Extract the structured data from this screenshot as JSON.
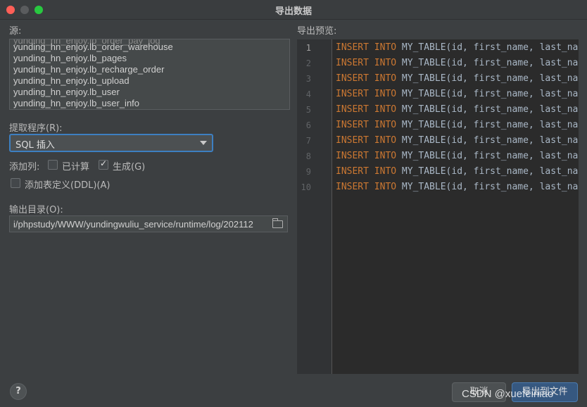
{
  "window": {
    "title": "导出数据"
  },
  "source": {
    "label": "源:",
    "items": [
      "yunding_hn_enjoy.lb_order_warehouse",
      "yunding_hn_enjoy.lb_pages",
      "yunding_hn_enjoy.lb_recharge_order",
      "yunding_hn_enjoy.lb_upload",
      "yunding_hn_enjoy.lb_user",
      "yunding_hn_enjoy.lb_user_info"
    ]
  },
  "extractor": {
    "label": "提取程序(R):",
    "value": "SQL 插入"
  },
  "add_columns": {
    "label": "添加列:",
    "computed_label": "已计算",
    "computed_checked": false,
    "generated_label": "生成(G)",
    "generated_checked": true
  },
  "ddl": {
    "label": "添加表定义(DDL)(A)",
    "checked": false
  },
  "output": {
    "label": "输出目录(O):",
    "value": "i/phpstudy/WWW/yundingwuliu_service/runtime/log/202112"
  },
  "preview": {
    "label": "导出预览:",
    "line_numbers": [
      "1",
      "2",
      "3",
      "4",
      "5",
      "6",
      "7",
      "8",
      "9",
      "10"
    ],
    "lines": [
      {
        "kw": "INSERT INTO",
        "rest": "MY_TABLE(id, first_name, last_na"
      },
      {
        "kw": "INSERT INTO",
        "rest": "MY_TABLE(id, first_name, last_na"
      },
      {
        "kw": "INSERT INTO",
        "rest": "MY_TABLE(id, first_name, last_na"
      },
      {
        "kw": "INSERT INTO",
        "rest": "MY_TABLE(id, first_name, last_na"
      },
      {
        "kw": "INSERT INTO",
        "rest": "MY_TABLE(id, first_name, last_na"
      },
      {
        "kw": "INSERT INTO",
        "rest": "MY_TABLE(id, first_name, last_na"
      },
      {
        "kw": "INSERT INTO",
        "rest": "MY_TABLE(id, first_name, last_na"
      },
      {
        "kw": "INSERT INTO",
        "rest": "MY_TABLE(id, first_name, last_na"
      },
      {
        "kw": "INSERT INTO",
        "rest": "MY_TABLE(id, first_name, last_na"
      },
      {
        "kw": "INSERT INTO",
        "rest": "MY_TABLE(id, first_name, last_na"
      }
    ]
  },
  "footer": {
    "help": "?",
    "cancel": "取消",
    "export": "导出到文件",
    "watermark": "CSDN @xuefeiniao"
  },
  "colors": {
    "accent": "#3d7fc1",
    "keyword": "#cc7832",
    "code": "#a9b7c6"
  }
}
